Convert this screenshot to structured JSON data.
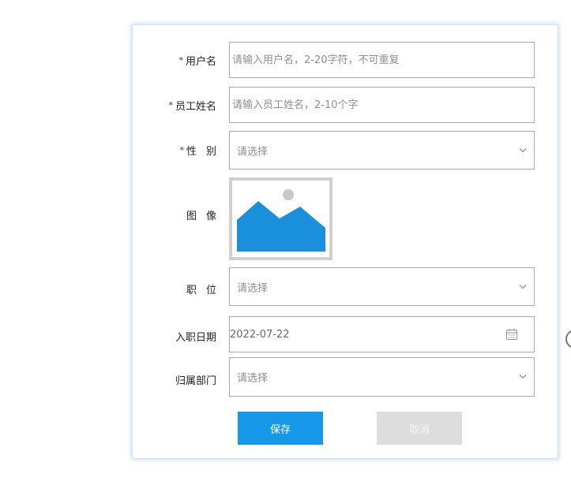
{
  "form": {
    "username": {
      "label": "用户名",
      "required_mark": "*",
      "value": "",
      "placeholder": "请输入用户名，2-20字符，不可重复"
    },
    "employee_name": {
      "label": "员工姓名",
      "required_mark": "*",
      "value": "",
      "placeholder": "请输入员工姓名，2-10个字"
    },
    "gender": {
      "label": "性别",
      "required_mark": "*",
      "selected": "请选择"
    },
    "avatar": {
      "label": "图像",
      "icon": "image-placeholder-icon"
    },
    "position": {
      "label": "职位",
      "selected": "请选择"
    },
    "hire_date": {
      "label": "入职日期",
      "value": "2022-07-22",
      "icon": "calendar-icon"
    },
    "department": {
      "label": "归属部门",
      "selected": "请选择"
    }
  },
  "buttons": {
    "save": "保存",
    "cancel": "取消"
  },
  "colors": {
    "primary": "#1597ea",
    "image_blue": "#1a8fdc",
    "border": "#a9a9a9",
    "disabled": "#dddddd"
  }
}
